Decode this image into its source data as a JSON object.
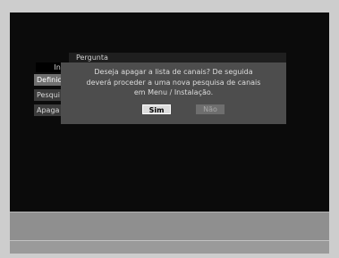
{
  "menu": {
    "title": "Ins",
    "items": [
      {
        "label": "Definic"
      },
      {
        "label": "Pesqui"
      },
      {
        "label": "Apaga"
      }
    ]
  },
  "dialog": {
    "title": "Pergunta",
    "message_lines": [
      "Deseja apagar a lista de canais? De seguida",
      "deverá proceder a uma nova pesquisa de canais",
      "em Menu / Instalação."
    ],
    "yes_label": "Sim",
    "no_label": "Não"
  }
}
